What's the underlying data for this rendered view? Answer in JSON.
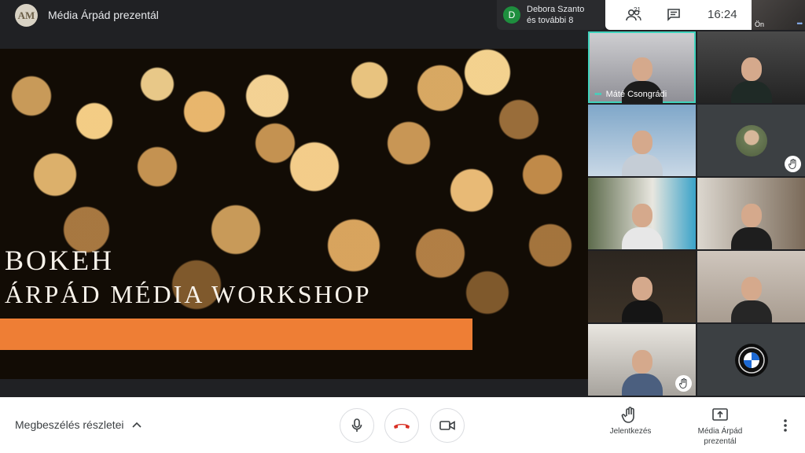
{
  "topbar": {
    "presenter_avatar_text": "AM",
    "presenter_title": "Média Árpád prezentál",
    "join_chip": {
      "initial": "D",
      "line1": "Debora Szanto",
      "line2": "és további 8"
    },
    "people_count": "21",
    "clock": "16:24",
    "self_label": "Ön",
    "self_dots": "•••"
  },
  "slide": {
    "line1": "BOKEH",
    "line2": "ÁRPÁD MÉDIA WORKSHOP",
    "accent_color": "#ee7e35"
  },
  "tiles": {
    "active_name": "Máté Csongrádi",
    "active_dots": "•••"
  },
  "bottombar": {
    "details_label": "Megbeszélés részletei",
    "raise_hand_label": "Jelentkezés",
    "present_label_1": "Média Árpád",
    "present_label_2": "prezentál"
  },
  "colors": {
    "active_outline": "#41d3bd",
    "hangup": "#d93025"
  },
  "icons": [
    "people-icon",
    "chat-icon",
    "mic-icon",
    "hangup-icon",
    "camera-icon",
    "hand-icon",
    "present-icon",
    "more-vert-icon",
    "chevron-up-icon"
  ]
}
